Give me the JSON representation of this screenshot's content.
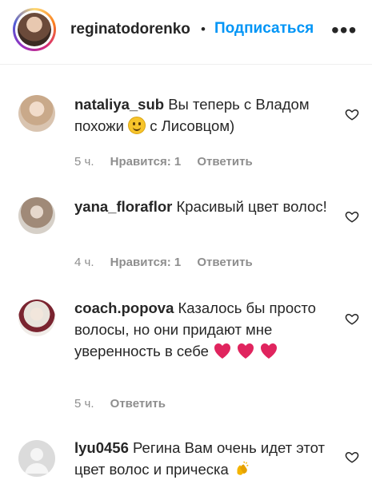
{
  "header": {
    "username": "reginatodorenko",
    "separator": "•",
    "follow_label": "Подписаться",
    "more_label": "•••"
  },
  "comments": [
    {
      "user": "nataliya_sub",
      "text_before": "Вы теперь с Владом похожи",
      "emoji": "smiling-face",
      "text_after": " с Лисовцом)",
      "time": "5 ч.",
      "likes": "Нравится: 1",
      "reply": "Ответить"
    },
    {
      "user": "yana_floraflor",
      "text": "Красивый цвет волос!",
      "time": "4 ч.",
      "likes": "Нравится: 1",
      "reply": "Ответить"
    },
    {
      "user": "coach.popova",
      "text": "Казалось бы просто волосы, но они придают мне уверенность в себе",
      "emoji": "red-heart ×3",
      "time": "5 ч.",
      "reply": "Ответить"
    },
    {
      "user": "lyu0456",
      "text": "Регина Вам очень идет этот цвет волос и прическа",
      "emoji": "clapping-hands"
    }
  ],
  "colors": {
    "follow_blue": "#0095f6",
    "meta_gray": "#8e8e8e",
    "heart_red": "#e0245e"
  }
}
